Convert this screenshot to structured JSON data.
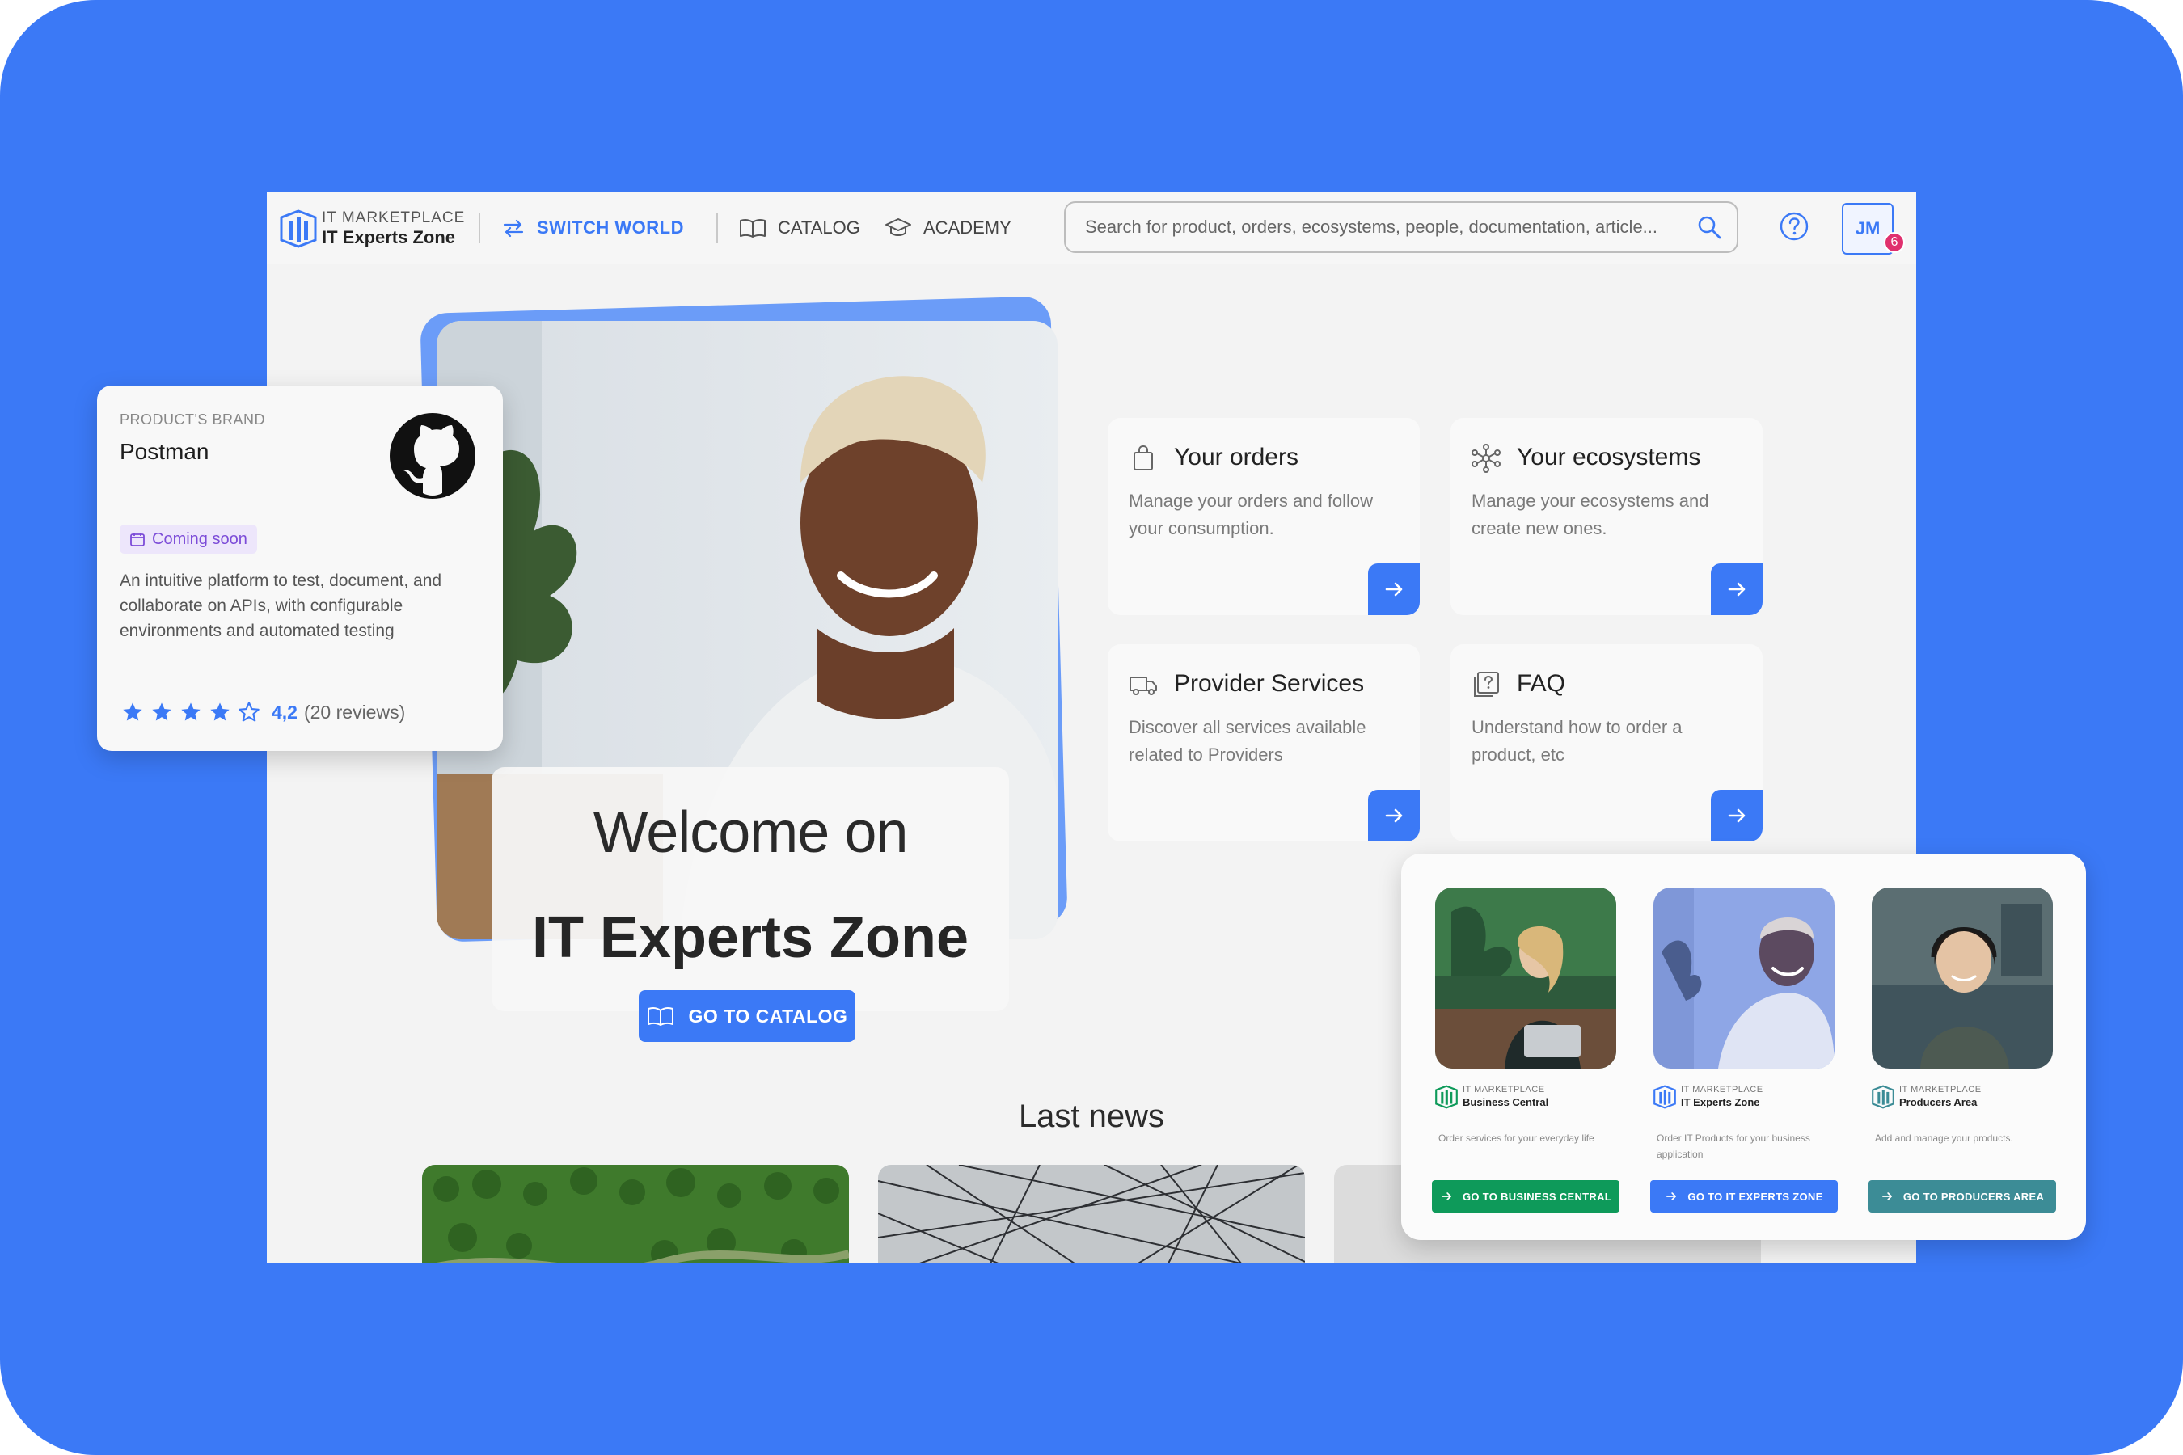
{
  "colors": {
    "background": "#3b79f6",
    "accent": "#3b79f6",
    "business_central": "#0e9a5a",
    "it_experts_zone": "#3b79f6",
    "producers_area": "#3c8c96",
    "coming_soon": "#7c4cd8",
    "badge": "#e0306e"
  },
  "header": {
    "logo_small": "IT MARKETPLACE",
    "logo_big": "IT Experts Zone",
    "switch_world": "SWITCH WORLD",
    "catalog": "CATALOG",
    "academy": "ACADEMY",
    "search_placeholder": "Search for product, orders, ecosystems, people, documentation, article...",
    "user_initials": "JM",
    "notifications": "6"
  },
  "hero": {
    "welcome_line1": "Welcome on",
    "welcome_line2": "IT Experts Zone",
    "cta": "GO TO CATALOG"
  },
  "cards": [
    {
      "icon": "shopping-bag-icon",
      "title": "Your orders",
      "description": "Manage your orders and follow your consumption."
    },
    {
      "icon": "network-icon",
      "title": "Your ecosystems",
      "description": "Manage your ecosystems and create new ones."
    },
    {
      "icon": "truck-icon",
      "title": "Provider Services",
      "description": "Discover all services available related to Providers"
    },
    {
      "icon": "faq-icon",
      "title": "FAQ",
      "description": "Understand how to order a product, etc"
    }
  ],
  "news": {
    "title": "Last news"
  },
  "product_card": {
    "kicker": "PRODUCT'S BRAND",
    "name": "Postman",
    "badge": "Coming soon",
    "description": "An intuitive platform to test, document, and collaborate on APIs, with configurable environments and automated testing",
    "rating_value": 4.2,
    "rating": "4,2",
    "reviews": "(20 reviews)"
  },
  "worlds": [
    {
      "small": "IT MARKETPLACE",
      "name": "Business Central",
      "description": "Order services for your everyday life",
      "button": "GO TO BUSINESS CENTRAL"
    },
    {
      "small": "IT MARKETPLACE",
      "name": "IT Experts Zone",
      "description": "Order IT Products for your business application",
      "button": "GO TO IT EXPERTS ZONE"
    },
    {
      "small": "IT MARKETPLACE",
      "name": "Producers Area",
      "description": "Add and manage your products.",
      "button": "GO TO PRODUCERS AREA"
    }
  ]
}
